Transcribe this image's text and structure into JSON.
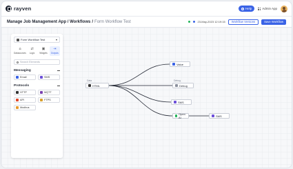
{
  "app": {
    "brand": "rayven"
  },
  "topbar": {
    "help_label": "Help",
    "admin_label": "Admin App"
  },
  "breadcrumb": {
    "path": "Manage Job Management App / Workflows",
    "separator": "/",
    "current": "Form Workflow Test"
  },
  "subheader": {
    "timestamp": "23-May-2023 12:19:15",
    "versions_label": "Workflow Versions",
    "save_label": "Save Workflow"
  },
  "panel": {
    "selected_workflow": "Form Workflow Test",
    "tabs": [
      {
        "label": "Datasources",
        "icon": "home-icon"
      },
      {
        "label": "Logic",
        "icon": "logic-icon"
      },
      {
        "label": "Widgets",
        "icon": "widgets-icon"
      },
      {
        "label": "Outputs",
        "icon": "outputs-icon"
      }
    ],
    "search_placeholder": "Search Elements",
    "groups": [
      {
        "title": "Messaging",
        "items": [
          {
            "label": "Email",
            "color": "#3a63e6"
          },
          {
            "label": "SMS",
            "color": "#6c4fd9"
          }
        ]
      },
      {
        "title": "Protocols",
        "items": [
          {
            "label": "HTTP",
            "color": "#333333"
          },
          {
            "label": "MQTT",
            "color": "#7a3fb0"
          },
          {
            "label": "API",
            "color": "#e0472a"
          },
          {
            "label": "FTPS",
            "color": "#d9a02b"
          },
          {
            "label": "Modbus",
            "color": "#e89b2c"
          }
        ]
      }
    ]
  },
  "flow": {
    "source": {
      "caption": "Data",
      "label": "HTML"
    },
    "targets": [
      {
        "label": "Value"
      },
      {
        "caption": "Debug",
        "label": "Debug"
      },
      {
        "label": "SMS"
      },
      {
        "label": "Open AI"
      }
    ],
    "chained": {
      "label": "SMS"
    }
  },
  "colors": {
    "accent": "#3a63e6",
    "status_green": "#22b35a"
  }
}
